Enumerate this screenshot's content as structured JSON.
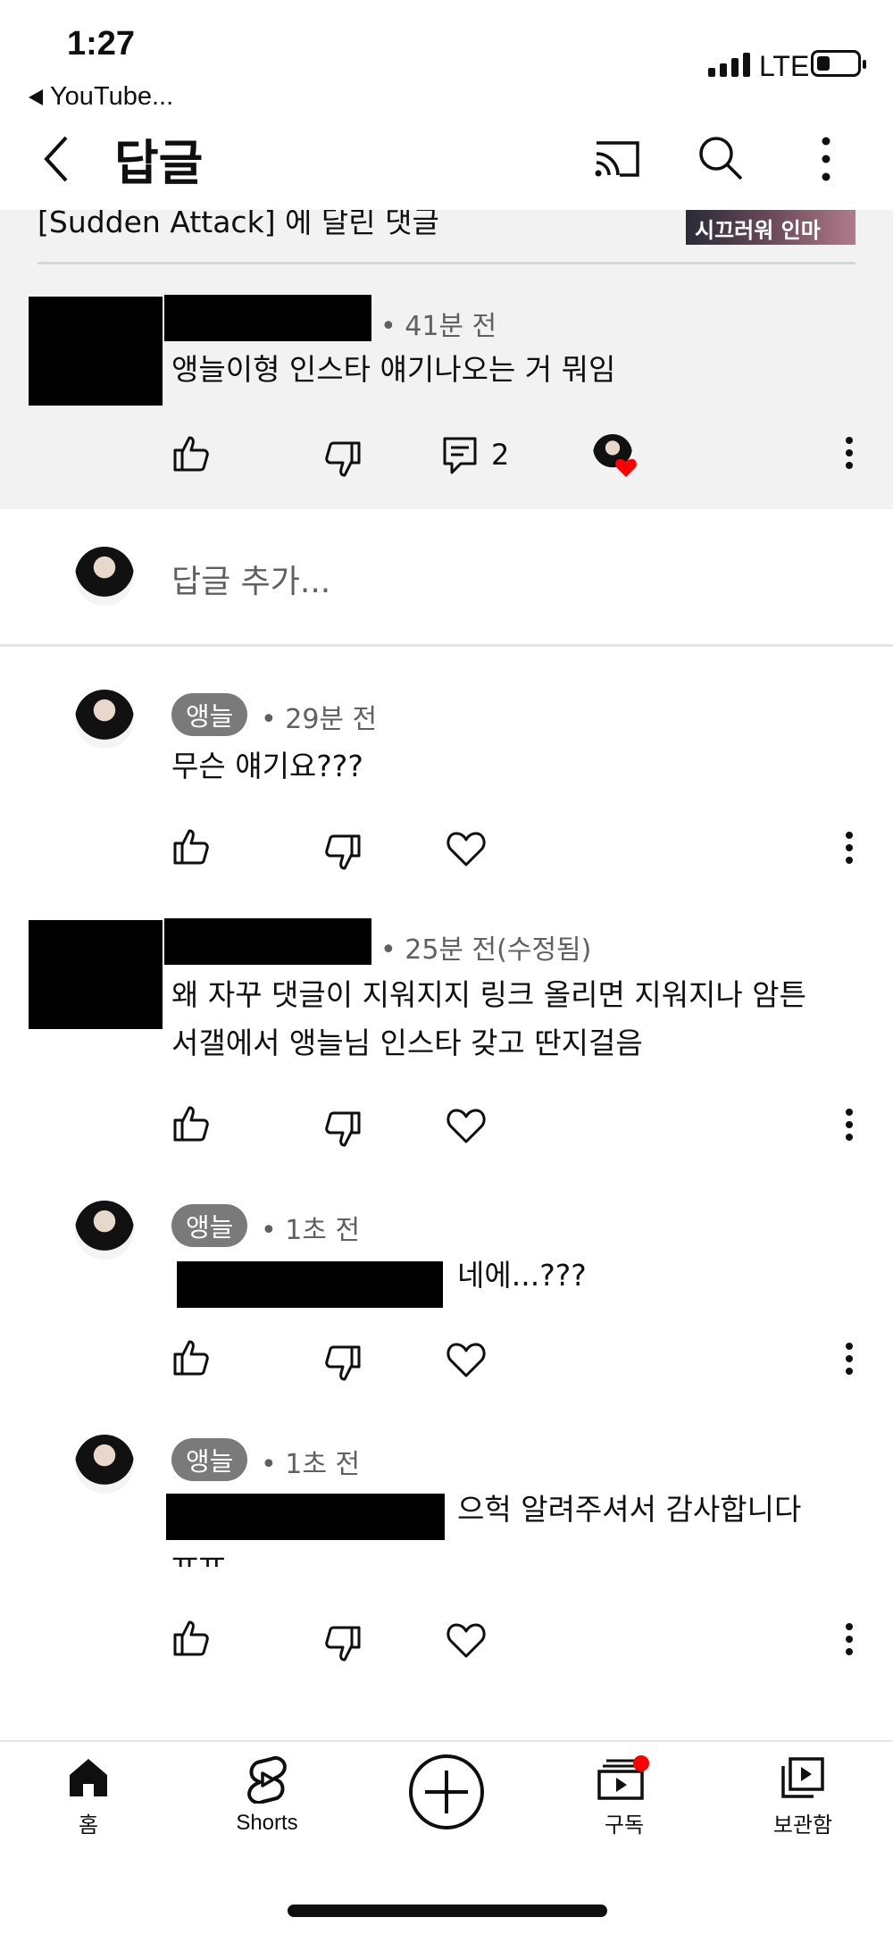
{
  "status_bar": {
    "time": "1:27",
    "back_app": "YouTube...",
    "network": "LTE"
  },
  "header": {
    "title": "답글"
  },
  "video": {
    "title": "[Sudden Attack] 에 달린 댓글",
    "thumbnail_text": "시끄러워 인마"
  },
  "parent_comment": {
    "time": "• 41분 전",
    "text": "앵늘이형 인스타 얘기나오는 거 뭐임",
    "reply_count": "2"
  },
  "reply_input": {
    "placeholder": "답글 추가..."
  },
  "replies": [
    {
      "author": "앵늘",
      "time": "• 29분 전",
      "text": "무슨 얘기요???"
    },
    {
      "author": "",
      "time": "• 25분 전(수정됨)",
      "text_line1": "왜 자꾸 댓글이 지워지지 링크 올리면 지워지나 암튼",
      "text_line2": "서갤에서 앵늘님 인스타 갖고 딴지걸음"
    },
    {
      "author": "앵늘",
      "time": "• 1초 전",
      "text": "네에...???"
    },
    {
      "author": "앵늘",
      "time": "• 1초 전",
      "text_line1": "으헉 알려주셔서 감사합니다",
      "text_line2": "ㅠㅠ"
    }
  ],
  "bottom_nav": [
    {
      "label": "홈",
      "icon": "home-icon"
    },
    {
      "label": "Shorts",
      "icon": "shorts-icon"
    },
    {
      "label": "",
      "icon": "create-plus-icon"
    },
    {
      "label": "구독",
      "icon": "subscriptions-icon"
    },
    {
      "label": "보관함",
      "icon": "library-icon"
    }
  ],
  "colors": {
    "badge": "#7a7a7a",
    "highlight_bg": "#f2f2f2",
    "notification_dot": "#ff0000",
    "heart": "#ff0000"
  }
}
